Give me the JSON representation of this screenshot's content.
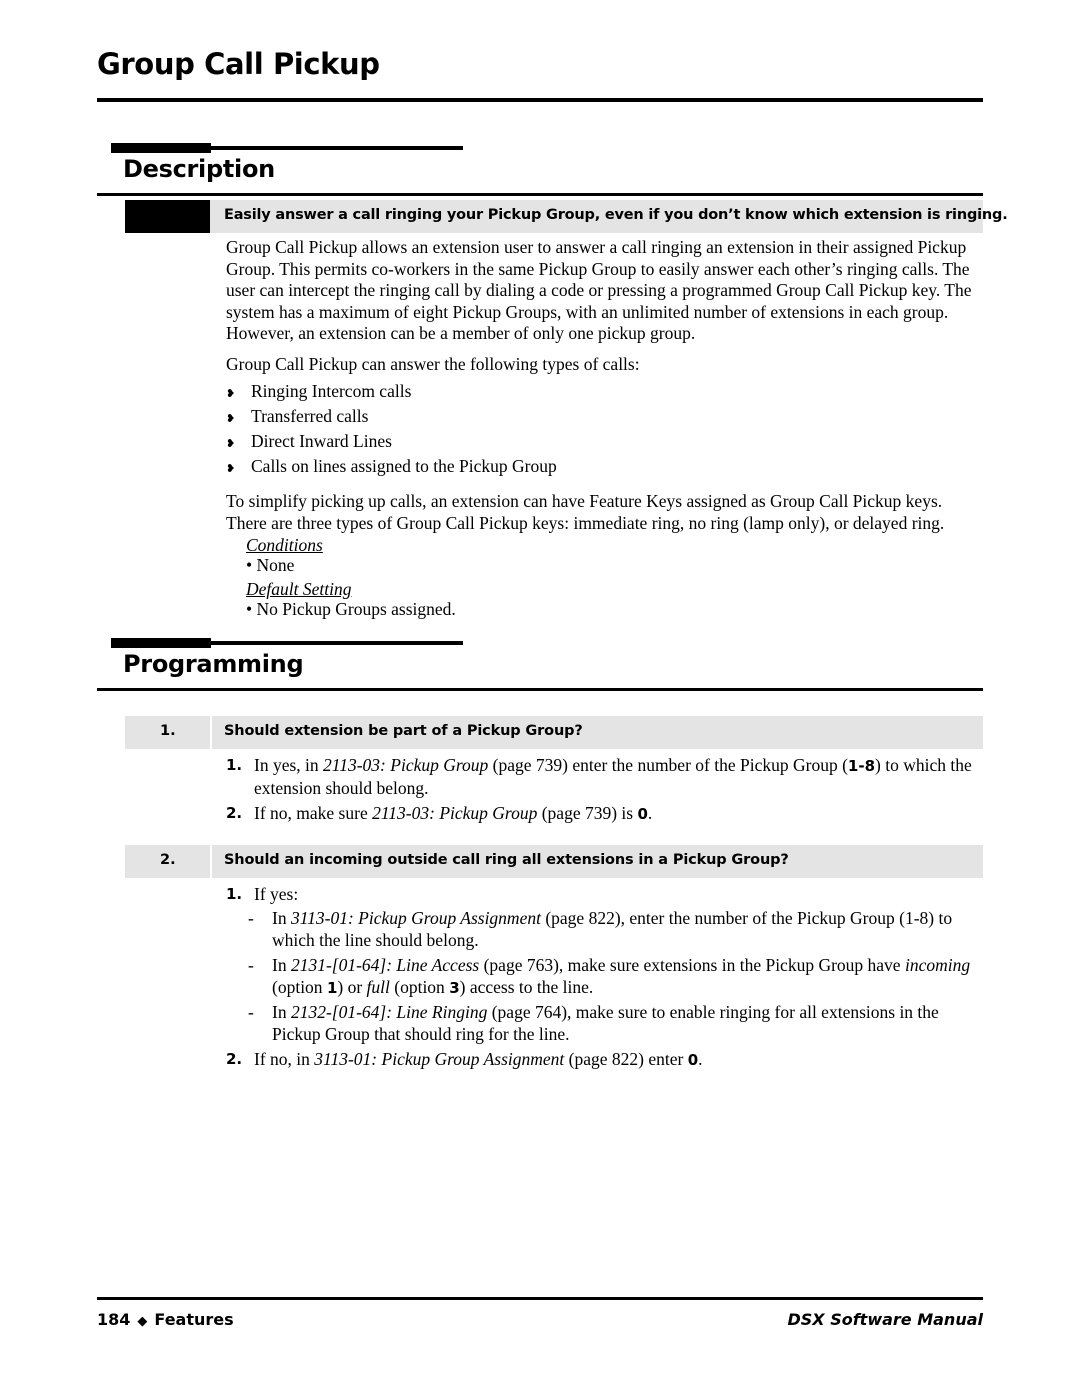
{
  "document": {
    "title": "Group Call Pickup"
  },
  "description": {
    "heading": "Description",
    "callout": "Easily answer a call ringing your Pickup Group, even if you don’t know which extension is ringing.",
    "paragraph1": "Group Call Pickup allows an extension user to answer a call ringing an extension in their assigned Pickup Group. This permits co-workers in the same Pickup Group to easily answer each other’s ringing calls. The user can intercept the ringing call by dialing a code or pressing a programmed Group Call Pickup key. The system has a maximum of eight Pickup Groups, with an unlimited number of extensions in each group. However, an extension can be a member of only one pickup group.",
    "paragraph2": "Group Call Pickup can answer the following types of calls:",
    "bullets": [
      "Ringing Intercom calls",
      "Transferred calls",
      "Direct Inward Lines",
      "Calls on lines assigned to the Pickup Group"
    ],
    "paragraph3": "To simplify picking up calls, an extension can have Feature Keys assigned as Group Call Pickup keys. There are three types of Group Call Pickup keys: immediate ring, no ring (lamp only), or delayed ring.",
    "conditions_label": "Conditions",
    "conditions_value": "• None",
    "default_setting_label": "Default Setting",
    "default_setting_value": "• No Pickup Groups assigned."
  },
  "programming": {
    "heading": "Programming",
    "item1": {
      "number": "1.",
      "question": "Should extension be part of a Pickup Group?",
      "step1_num": "1.",
      "step1_a": "In yes, in ",
      "step1_ref": "2113-03: Pickup Group",
      "step1_b": " (page 739) enter the number of the Pickup Group (",
      "step1_bold": "1-8",
      "step1_c": ") to which the extension should belong.",
      "step2_num": "2.",
      "step2_a": "If no, make sure ",
      "step2_ref": "2113-03: Pickup Group",
      "step2_b": " (page 739) is ",
      "step2_bold": "0",
      "step2_c": "."
    },
    "item2": {
      "number": "2.",
      "question": "Should an incoming outside call ring all extensions in a Pickup Group?",
      "step1_num": "1.",
      "step1_text": "If yes:",
      "dash1_a": "In ",
      "dash1_ref": "3113-01: Pickup Group Assignment",
      "dash1_b": " (page 822), enter the number of the Pickup Group (1-8) to which the line should belong.",
      "dash2_a": "In ",
      "dash2_ref": "2131-[01-64]: Line Access",
      "dash2_b": " (page 763), make sure extensions in the Pickup Group have ",
      "dash2_it1": "incoming",
      "dash2_c": " (option ",
      "dash2_bold1": "1",
      "dash2_d": ") or ",
      "dash2_it2": "full",
      "dash2_e": " (option ",
      "dash2_bold2": "3",
      "dash2_f": ") access to the line.",
      "dash3_a": "In ",
      "dash3_ref": "2132-[01-64]: Line Ringing",
      "dash3_b": " (page 764), make sure to enable ringing for all extensions in the Pickup Group that should ring for the line.",
      "step2_num": "2.",
      "step2_a": "If no, in ",
      "step2_ref": "3113-01: Pickup Group Assignment",
      "step2_b": " (page 822) enter ",
      "step2_bold": "0",
      "step2_c": "."
    }
  },
  "footer": {
    "page_number": "184",
    "diamond": "◆",
    "section": "Features",
    "manual": "DSX Software Manual"
  },
  "colors": {
    "band_grey": "#e4e4e4",
    "rule_black": "#000000"
  }
}
